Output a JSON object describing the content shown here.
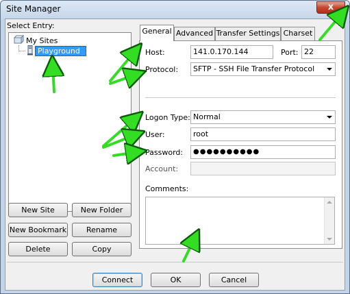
{
  "window": {
    "title": "Site Manager",
    "close_glyph": "x"
  },
  "left": {
    "select_label": "Select Entry:",
    "tree": {
      "root_label": "My Sites",
      "child_label": "Playground"
    },
    "buttons": {
      "new_site": "New Site",
      "new_folder": "New Folder",
      "new_bookmark": "New Bookmark",
      "rename": "Rename",
      "delete": "Delete",
      "copy": "Copy"
    }
  },
  "tabs": [
    {
      "label": "General",
      "active": true
    },
    {
      "label": "Advanced"
    },
    {
      "label": "Transfer Settings"
    },
    {
      "label": "Charset"
    }
  ],
  "general": {
    "host_label": "Host:",
    "host_value": "141.0.170.144",
    "port_label": "Port:",
    "port_value": "22",
    "protocol_label": "Protocol:",
    "protocol_value": "SFTP - SSH File Transfer Protocol",
    "logon_label": "Logon Type:",
    "logon_value": "Normal",
    "user_label": "User:",
    "user_value": "root",
    "password_label": "Password:",
    "password_value": "●●●●●●●●●●",
    "account_label": "Account:",
    "account_value": "",
    "comments_label": "Comments:"
  },
  "footer": {
    "connect": "Connect",
    "ok": "OK",
    "cancel": "Cancel"
  },
  "colors": {
    "annotation_arrow": "#33dd22",
    "selection": "#3399ff"
  },
  "icons": {
    "folder": "folder-icon",
    "server": "server-icon",
    "annotation": "arrow-icon"
  }
}
